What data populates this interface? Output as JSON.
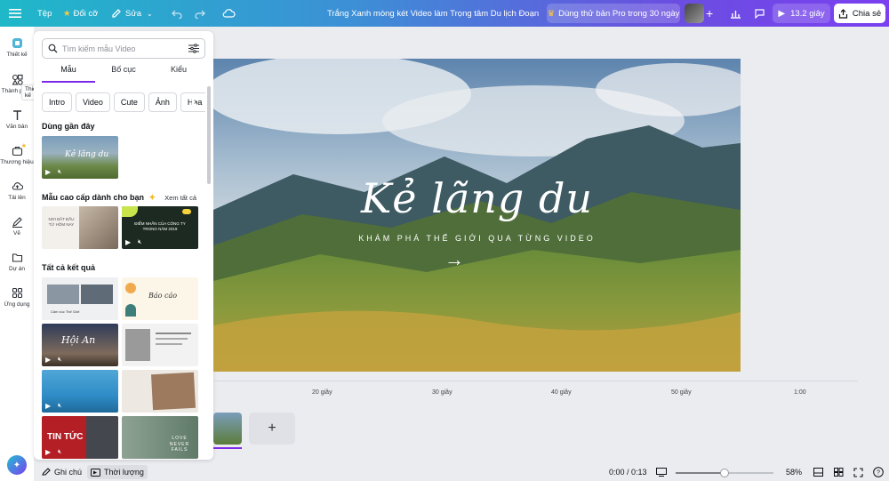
{
  "topbar": {
    "menu_icon": "hamburger-menu-icon",
    "file": "Tệp",
    "resize": "Đổi cỡ",
    "edit": "Sửa",
    "title": "Trắng Xanh mòng két Video làm Trọng tâm Du lịch Đoạn Giới thiệu",
    "pro_trial": "Dùng thử bản Pro trong 30 ngày",
    "duration": "13.2 giây",
    "share": "Chia sẻ"
  },
  "rail": {
    "items": [
      {
        "label": "Thiết kế",
        "icon": "design-icon"
      },
      {
        "label": "Thành phần",
        "icon": "elements-icon"
      },
      {
        "label": "Văn bản",
        "icon": "text-icon"
      },
      {
        "label": "Thương hiệu",
        "icon": "brand-icon"
      },
      {
        "label": "Tải lên",
        "icon": "upload-icon"
      },
      {
        "label": "Vẽ",
        "icon": "draw-icon"
      },
      {
        "label": "Dự án",
        "icon": "projects-icon"
      },
      {
        "label": "Ứng dụng",
        "icon": "apps-icon"
      }
    ],
    "tooltip": "Thiết kế"
  },
  "panel": {
    "search_placeholder": "Tìm kiếm mẫu Video",
    "tabs": [
      "Mẫu",
      "Bố cục",
      "Kiểu"
    ],
    "chips": [
      "Intro",
      "Video",
      "Cute",
      "Ảnh",
      "Hoa"
    ],
    "recent_title": "Dùng gần đây",
    "premium_title": "Mẫu cao cấp dành cho bạn",
    "see_all": "Xem tất cả",
    "all_results_title": "Tất cả kết quả",
    "thumb_texts": {
      "recent": "Kẻ lãng du",
      "premium_1": "NƠI BẮT ĐẦU TỪ HÔM NAY",
      "premium_2": "ĐIỂM NHẤN CỦA CÔNG TY TRONG NĂM 2019",
      "r1": "Cảm xúc Thế Giới",
      "r2": "Báo cáo",
      "r4": "Hội An",
      "r8": "TIN TỨC",
      "r9": "LOVE NEVER FAILS"
    }
  },
  "canvas": {
    "title": "Kẻ lãng du",
    "subtitle": "KHÁM PHÁ THẾ GIỚI QUA TỪNG VIDEO",
    "arrow": "→"
  },
  "timeline": {
    "ticks": [
      "20 giây",
      "30 giây",
      "40 giây",
      "50 giây",
      "1:00"
    ],
    "add_clip": "+"
  },
  "bottombar": {
    "notes": "Ghi chú",
    "duration": "Thời lượng",
    "time": "0:00 / 0:13",
    "zoom": "58%",
    "zoom_level": 0.58
  },
  "colors": {
    "accent": "#7d2ae8",
    "topbar_start": "#1fb8c9",
    "topbar_end": "#7a3ff0"
  }
}
